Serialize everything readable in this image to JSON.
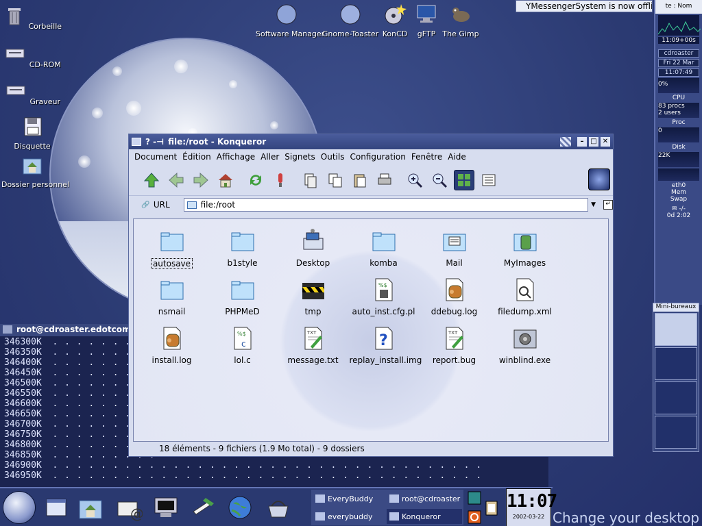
{
  "desktop": {
    "icons": [
      {
        "label": "Corbeille"
      },
      {
        "label": "CD-ROM"
      },
      {
        "label": "Graveur"
      },
      {
        "label": "Disquette"
      },
      {
        "label": "Dossier personnel"
      }
    ],
    "launchers": [
      {
        "label": "Software Manager"
      },
      {
        "label": "Gnome-Toaster"
      },
      {
        "label": "KonCD"
      },
      {
        "label": "gFTP"
      },
      {
        "label": "The Gimp"
      }
    ],
    "notification": "YMessengerSystem is now offline",
    "wallpaper_text": "Change your desktop"
  },
  "gkrellm": {
    "header": "te : Nom",
    "top_clock": "11:09+00s",
    "hostname": "cdroaster",
    "date": "Fri 22 Mar",
    "time": "11:07:49",
    "cpu_pct": "0%",
    "cpu_label": "CPU",
    "procs": "83 procs",
    "users": "2 users",
    "proc_label": "Proc",
    "disk_zero": "0",
    "disk_label": "Disk",
    "net_val": "22K",
    "eth_label": "eth0",
    "mem_label": "Mem",
    "swap_label": "Swap",
    "mail_val": "-/-",
    "uptime": "0d 2:02"
  },
  "pager": {
    "title": "Mini-bureaux"
  },
  "terminal": {
    "title": "root@cdroaster.edotcom",
    "lines": [
      "346300K",
      "346350K",
      "346400K",
      "346450K",
      "346500K",
      "346550K",
      "346600K",
      "346650K",
      "346700K",
      "346750K",
      "346800K",
      "346850K",
      "346900K",
      "346950K"
    ]
  },
  "konqueror": {
    "title": "file:/root - Konqueror",
    "title_prefix": "?  -⊣",
    "menu": [
      "Document",
      "Édition",
      "Affichage",
      "Aller",
      "Signets",
      "Outils",
      "Configuration",
      "Fenêtre",
      "Aide"
    ],
    "url_label": "URL",
    "url_value": "file:/root",
    "files": [
      {
        "name": "autosave",
        "icon": "folder-icon"
      },
      {
        "name": "b1style",
        "icon": "folder-icon"
      },
      {
        "name": "Desktop",
        "icon": "desktop-folder-icon"
      },
      {
        "name": "komba",
        "icon": "folder-icon"
      },
      {
        "name": "Mail",
        "icon": "mail-folder-icon"
      },
      {
        "name": "MyImages",
        "icon": "images-folder-icon"
      },
      {
        "name": "nsmail",
        "icon": "folder-icon"
      },
      {
        "name": "PHPMeD",
        "icon": "folder-icon"
      },
      {
        "name": "tmp",
        "icon": "tmp-folder-icon"
      },
      {
        "name": "auto_inst.cfg.pl",
        "icon": "script-file-icon"
      },
      {
        "name": "ddebug.log",
        "icon": "log-file-icon"
      },
      {
        "name": "filedump.xml",
        "icon": "xml-file-icon"
      },
      {
        "name": "install.log",
        "icon": "log-file-icon"
      },
      {
        "name": "lol.c",
        "icon": "c-source-icon"
      },
      {
        "name": "message.txt",
        "icon": "text-file-icon"
      },
      {
        "name": "replay_install.img",
        "icon": "unknown-file-icon"
      },
      {
        "name": "report.bug",
        "icon": "text-file-icon"
      },
      {
        "name": "winblind.exe",
        "icon": "exe-file-icon"
      }
    ],
    "status": "18 éléments - 9 fichiers (1.9 Mo total) - 9 dossiers"
  },
  "taskbar": {
    "tasks": [
      {
        "label": "EveryBuddy"
      },
      {
        "label": "root@cdroaster"
      },
      {
        "label": "everybuddy"
      },
      {
        "label": "Konqueror"
      }
    ],
    "clock_time": "11:07",
    "clock_date": "2002-03-22"
  },
  "colors": {
    "desktop_bg": "#2f3f78",
    "window_bg": "#d7ddef",
    "titlebar": "#3a4c8c"
  }
}
